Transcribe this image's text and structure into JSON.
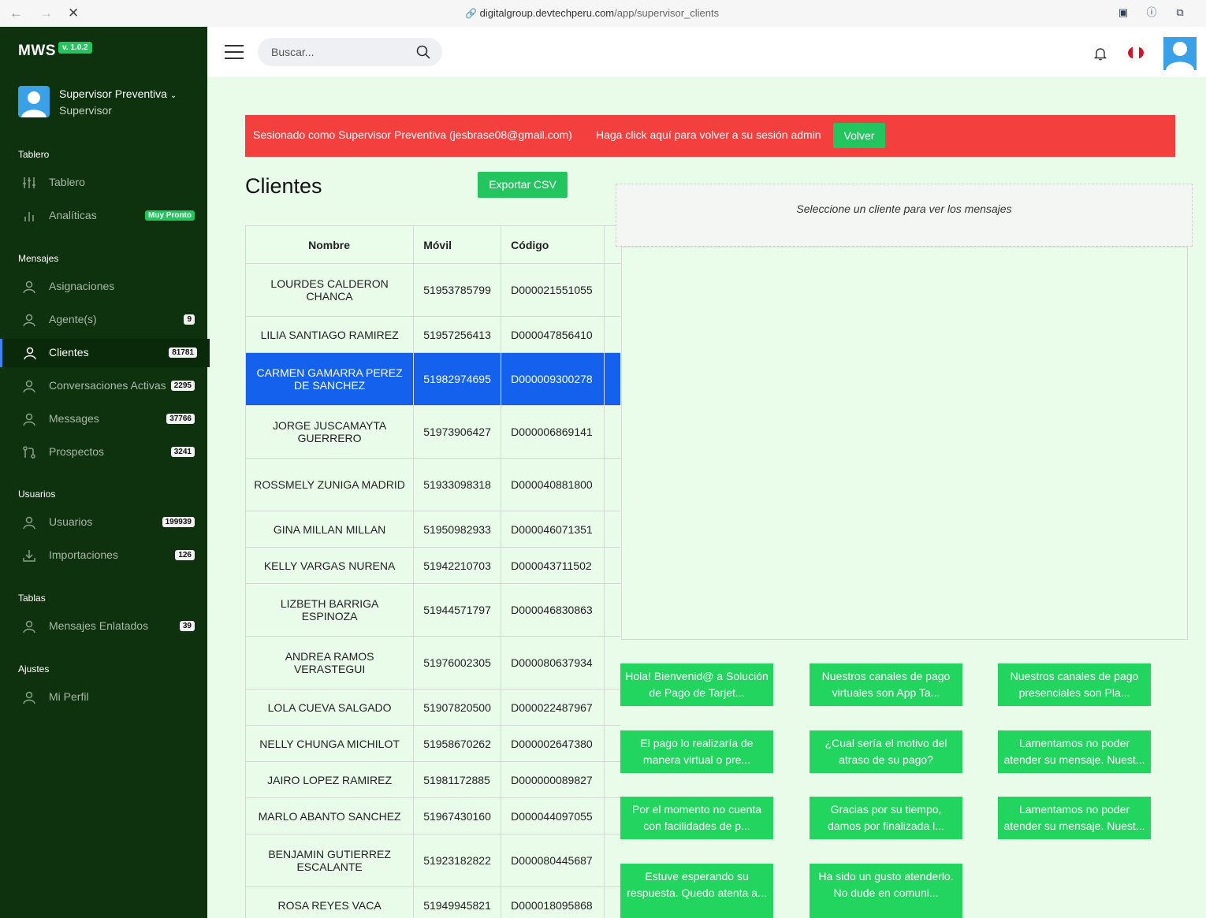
{
  "browser": {
    "url_domain": "digitalgroup.devtechperu.com",
    "url_path": "/app/supervisor_clients"
  },
  "sidebar": {
    "brand": "MWS",
    "version": "v. 1.0.2",
    "user_name": "Supervisor Preventiva",
    "user_role": "Supervisor",
    "sections": {
      "tablero": "Tablero",
      "mensajes": "Mensajes",
      "usuarios": "Usuarios",
      "tablas": "Tablas",
      "ajustes": "Ajustes"
    },
    "items": [
      {
        "label": "Tablero",
        "icon": "sliders-icon"
      },
      {
        "label": "Analíticas",
        "icon": "bar-chart-icon",
        "badge": "Muy Pronto"
      },
      {
        "label": "Asignaciones",
        "icon": "user-icon"
      },
      {
        "label": "Agente(s)",
        "icon": "user-icon",
        "badge": "9"
      },
      {
        "label": "Clientes",
        "icon": "user-icon",
        "badge": "81781"
      },
      {
        "label": "Conversaciones Activas",
        "icon": "user-icon",
        "badge": "2295"
      },
      {
        "label": "Messages",
        "icon": "user-icon",
        "badge": "37766"
      },
      {
        "label": "Prospectos",
        "icon": "git-pull-request-icon",
        "badge": "3241"
      },
      {
        "label": "Usuarios",
        "icon": "user-icon",
        "badge": "199939"
      },
      {
        "label": "Importaciones",
        "icon": "download-icon",
        "badge": "126"
      },
      {
        "label": "Mensajes Enlatados",
        "icon": "user-icon",
        "badge": "39"
      },
      {
        "label": "Mi Perfil",
        "icon": "user-icon"
      }
    ]
  },
  "topbar": {
    "search_placeholder": "Buscar..."
  },
  "alert": {
    "message": "Sesionado como Supervisor Preventiva (jesbrase08@gmail.com)",
    "prompt": "Haga click aquí para volver a su sesión admin",
    "button": "Volver"
  },
  "page": {
    "title": "Clientes",
    "export_button": "Exportar CSV"
  },
  "table": {
    "headers": [
      "Nombre",
      "Móvil",
      "Código"
    ],
    "rows": [
      [
        "LOURDES CALDERON CHANCA",
        "51953785799",
        "D000021551055"
      ],
      [
        "LILIA SANTIAGO RAMIREZ",
        "51957256413",
        "D000047856410"
      ],
      [
        "CARMEN GAMARRA PEREZ DE SANCHEZ",
        "51982974695",
        "D000009300278"
      ],
      [
        "JORGE JUSCAMAYTA GUERRERO",
        "51973906427",
        "D000006869141"
      ],
      [
        "ROSSMELY ZUNIGA MADRID",
        "51933098318",
        "D000040881800"
      ],
      [
        "GINA MILLAN MILLAN",
        "51950982933",
        "D000046071351"
      ],
      [
        "KELLY VARGAS NURENA",
        "51942210703",
        "D000043711502"
      ],
      [
        "LIZBETH BARRIGA ESPINOZA",
        "51944571797",
        "D000046830863"
      ],
      [
        "ANDREA RAMOS VERASTEGUI",
        "51976002305",
        "D000080637934"
      ],
      [
        "LOLA CUEVA SALGADO",
        "51907820500",
        "D000022487967"
      ],
      [
        "NELLY CHUNGA MICHILOT",
        "51958670262",
        "D000002647380"
      ],
      [
        "JAIRO LOPEZ RAMIREZ",
        "51981172885",
        "D000000089827"
      ],
      [
        "MARLO ABANTO SANCHEZ",
        "51967430160",
        "D000044097055"
      ],
      [
        "BENJAMIN GUTIERREZ ESCALANTE",
        "51923182822",
        "D000080445687"
      ],
      [
        "ROSA REYES VACA",
        "51949945821",
        "D000018095868"
      ]
    ]
  },
  "messages": {
    "empty": "Seleccione un cliente para ver los mensajes"
  },
  "templates": [
    "Hola! Bienvenid@ a Solución de Pago de Tarjet...",
    "Nuestros canales de pago virtuales son App Ta...",
    "Nuestros canales de pago presenciales son Pla...",
    "El pago lo realizaría de manera virtual o pre...",
    "¿Cual sería el motivo del atraso de su pago?",
    "Lamentamos no poder atender su mensaje. Nuest...",
    "Por el momento no cuenta con facilidades de p...",
    "Gracias por su tiempo, damos por finalizada l...",
    "Lamentamos no poder atender su mensaje. Nuest...",
    "Estuve esperando su respuesta. Quedo atenta a...",
    "Ha sido un gusto atenderlo. No dude en comuni..."
  ]
}
